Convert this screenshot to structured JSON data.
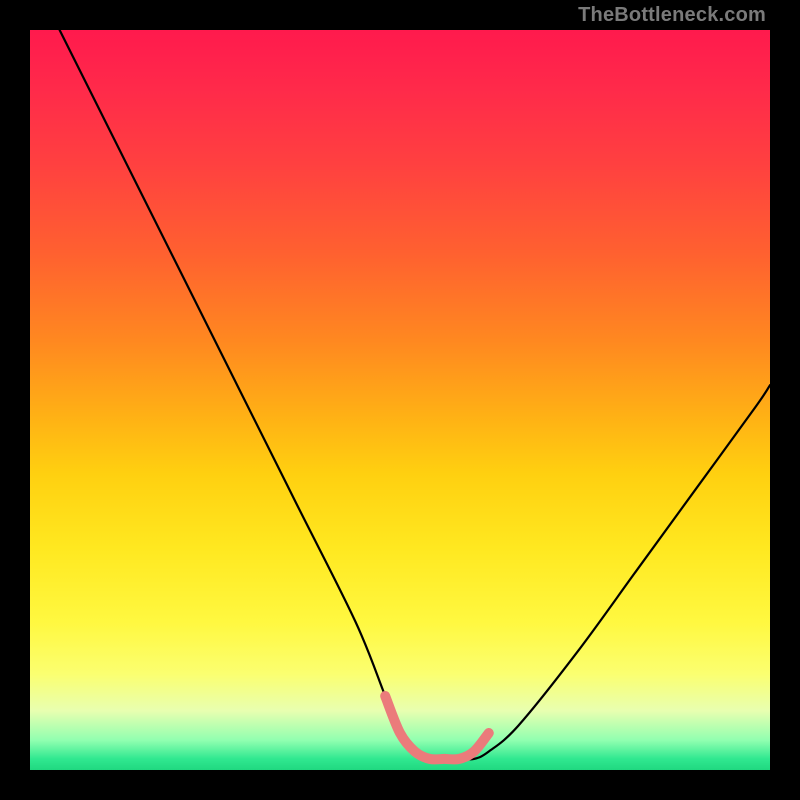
{
  "watermark": "TheBottleneck.com",
  "chart_data": {
    "type": "line",
    "title": "",
    "xlabel": "",
    "ylabel": "",
    "xlim": [
      0,
      100
    ],
    "ylim": [
      0,
      100
    ],
    "series": [
      {
        "name": "black-curve",
        "color": "#000000",
        "x": [
          4,
          12,
          20,
          28,
          36,
          44,
          48,
          50,
          52,
          54,
          56,
          58,
          60,
          62,
          66,
          74,
          82,
          90,
          98,
          100
        ],
        "y": [
          100,
          84,
          68,
          52,
          36,
          20,
          10,
          5,
          2.5,
          1.5,
          1.5,
          1.5,
          1.5,
          2.5,
          6,
          16,
          27,
          38,
          49,
          52
        ]
      },
      {
        "name": "pink-segment",
        "color": "#eb7b7b",
        "x": [
          48,
          50,
          52,
          54,
          56,
          58,
          60,
          62
        ],
        "y": [
          10,
          5,
          2.5,
          1.5,
          1.5,
          1.5,
          2.5,
          5
        ]
      }
    ]
  }
}
